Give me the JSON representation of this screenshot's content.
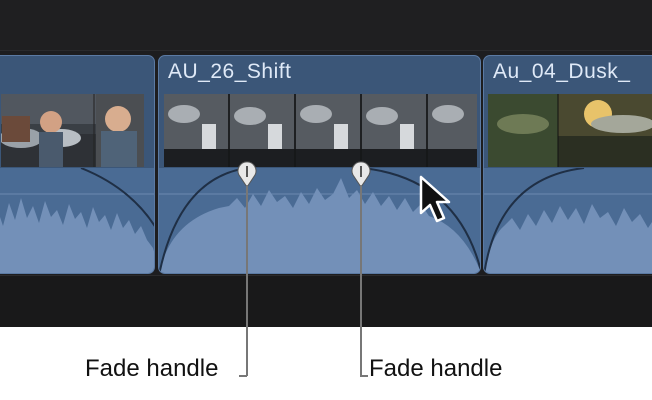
{
  "clips": [
    {
      "name": ""
    },
    {
      "name": "AU_26_Shift"
    },
    {
      "name": "Au_04_Dusk_"
    }
  ],
  "callouts": [
    {
      "label": "Fade handle"
    },
    {
      "label": "Fade handle"
    }
  ],
  "icons": {
    "fade_handle": "fade-handle-icon",
    "pointer": "mouse-pointer-icon"
  },
  "colors": {
    "clip_fill": "#3b5678",
    "clip_border": "#5b7aa3",
    "waveform": "#7390b8",
    "timeline_bg": "#1d1d1f"
  }
}
